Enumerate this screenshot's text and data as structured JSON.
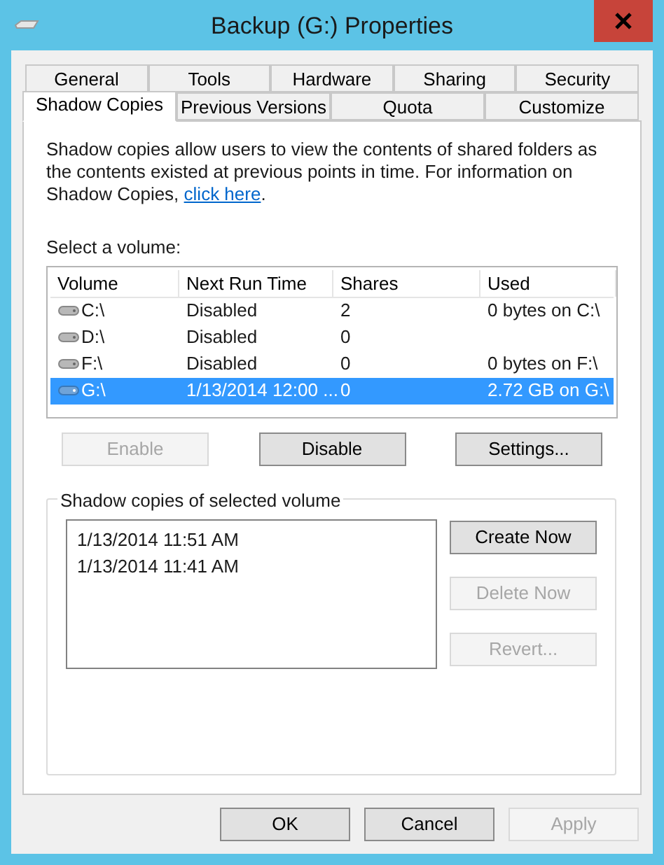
{
  "window": {
    "title": "Backup (G:) Properties"
  },
  "tab_rows": [
    [
      {
        "label": "General",
        "selected": false
      },
      {
        "label": "Tools",
        "selected": false
      },
      {
        "label": "Hardware",
        "selected": false
      },
      {
        "label": "Sharing",
        "selected": false
      },
      {
        "label": "Security",
        "selected": false
      }
    ],
    [
      {
        "label": "Shadow Copies",
        "selected": true
      },
      {
        "label": "Previous Versions",
        "selected": false
      },
      {
        "label": "Quota",
        "selected": false
      },
      {
        "label": "Customize",
        "selected": false
      }
    ]
  ],
  "description": "Shadow copies allow users to view the contents of shared folders as the contents existed at previous points in time. For information on Shadow Copies,",
  "link": "click here",
  "link_after": ".",
  "volume_label": "Select a volume:",
  "volumes": {
    "columns": [
      "Volume",
      "Next Run Time",
      "Shares",
      "Used"
    ],
    "rows": [
      {
        "cells": [
          "C:\\",
          "Disabled",
          "2",
          "0 bytes on C:\\"
        ],
        "selected": false
      },
      {
        "cells": [
          "D:\\",
          "Disabled",
          "0",
          ""
        ],
        "selected": false
      },
      {
        "cells": [
          "F:\\",
          "Disabled",
          "0",
          "0 bytes on F:\\"
        ],
        "selected": false
      },
      {
        "cells": [
          "G:\\",
          "1/13/2014 12:00 ...",
          "0",
          "2.72 GB on G:\\"
        ],
        "selected": true
      }
    ]
  },
  "volume_buttons": [
    {
      "label": "Enable",
      "disabled": true
    },
    {
      "label": "Disable",
      "disabled": false
    },
    {
      "label": "Settings...",
      "disabled": false
    }
  ],
  "copies_group": {
    "title": "Shadow copies of selected volume",
    "items": [
      "1/13/2014 11:51 AM",
      "1/13/2014 11:41 AM"
    ],
    "buttons": [
      {
        "label": "Create Now",
        "disabled": false
      },
      {
        "label": "Delete Now",
        "disabled": true
      },
      {
        "label": "Revert...",
        "disabled": true
      }
    ]
  },
  "dialog_buttons": [
    {
      "label": "OK",
      "disabled": false
    },
    {
      "label": "Cancel",
      "disabled": false
    },
    {
      "label": "Apply",
      "disabled": true
    }
  ]
}
